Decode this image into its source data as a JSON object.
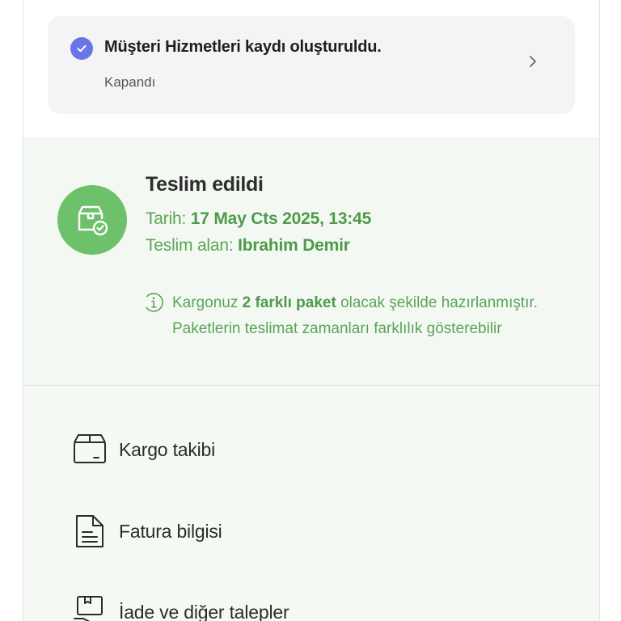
{
  "customer_service": {
    "title": "Müşteri Hizmetleri kaydı oluşturuldu.",
    "status": "Kapandı",
    "check_color": "#6b74e6"
  },
  "delivery": {
    "title": "Teslim edildi",
    "date_label": "Tarih: ",
    "date_value": "17 May Cts 2025, 13:45",
    "receiver_label": "Teslim alan: ",
    "receiver_value": "Ibrahim Demir",
    "accent_color": "#6cc16a"
  },
  "info": {
    "prefix": "Kargonuz ",
    "highlight": "2 farklı paket",
    "suffix": " olacak şekilde hazırlanmıştır. Paketlerin teslimat zamanları farklılık gösterebilir"
  },
  "menu": {
    "items": [
      {
        "label": "Kargo takibi",
        "icon": "box-icon"
      },
      {
        "label": "Fatura bilgisi",
        "icon": "invoice-icon"
      },
      {
        "label": "İade ve diğer talepler",
        "icon": "return-icon"
      }
    ]
  }
}
